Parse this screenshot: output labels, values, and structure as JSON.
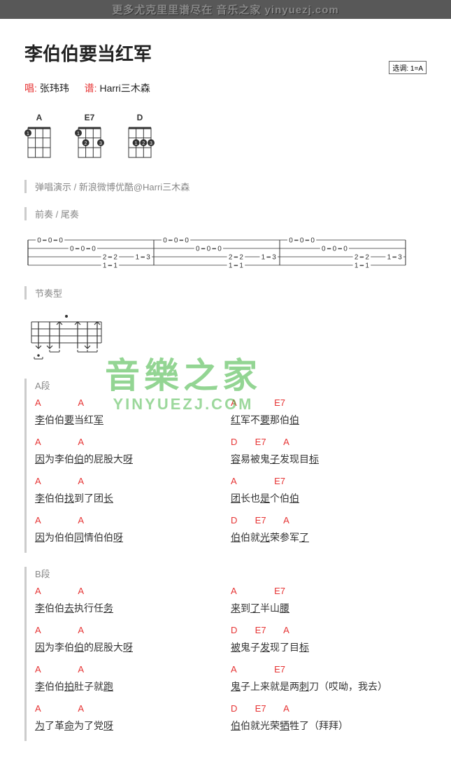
{
  "header_text": "更多尤克里里谱尽在 音乐之家 yinyuezj.com",
  "title": "李伯伯要当红军",
  "key_label": "选调: 1=A",
  "credit_sing_label": "唱:",
  "credit_sing_name": "张玮玮",
  "credit_tab_label": "谱:",
  "credit_tab_name": "Harri三木森",
  "chords": [
    "A",
    "E7",
    "D"
  ],
  "demo_note": "弹唱演示 / 新浪微博优酷@Harri三木森",
  "intro_outro_label": "前奏 / 尾奏",
  "rhythm_label": "节奏型",
  "watermark_cn": "音樂之家",
  "watermark_en": "YINYUEZJ.COM",
  "sectionA_label": "A段",
  "sectionB_label": "B段",
  "A": {
    "r1": {
      "c1_ch": "A               A",
      "c1_ly": "李伯伯要当红军",
      "c2_ch": "A               E7",
      "c2_ly": "红军不要那伯伯"
    },
    "r2": {
      "c1_ch": "A               A",
      "c1_ly": "因为李伯伯的屁股大呀",
      "c2_ch": "D       E7       A",
      "c2_ly": "容易被鬼子发现目标"
    },
    "r3": {
      "c1_ch": "A               A",
      "c1_ly": "李伯伯找到了团长",
      "c2_ch": "A               E7",
      "c2_ly": "团长也是个伯伯"
    },
    "r4": {
      "c1_ch": "A               A",
      "c1_ly": "因为伯伯同情伯伯呀",
      "c2_ch": "D       E7       A",
      "c2_ly": "伯伯就光荣参军了"
    }
  },
  "B": {
    "r1": {
      "c1_ch": "A               A",
      "c1_ly": "李伯伯去执行任务",
      "c2_ch": "A               E7",
      "c2_ly": "来到了半山腰"
    },
    "r2": {
      "c1_ch": "A               A",
      "c1_ly": "因为李伯伯的屁股大呀",
      "c2_ch": "D       E7       A",
      "c2_ly": "被鬼子发现了目标"
    },
    "r3": {
      "c1_ch": "A               A",
      "c1_ly": "李伯伯拍肚子就跑",
      "c2_ch": "A               E7",
      "c2_ly": "鬼子上来就是两刺刀（哎呦，我去）"
    },
    "r4": {
      "c1_ch": "A               A",
      "c1_ly": "为了革命为了党呀",
      "c2_ch": "D       E7       A",
      "c2_ly": "伯伯就光荣牺牲了（拜拜）"
    }
  },
  "chart_data": {
    "type": "table",
    "description": "Ukulele tablature - intro/outro riff, 3 measures, 4 strings (top to bottom: A E C G)",
    "string_names": [
      "A",
      "E",
      "C",
      "G"
    ],
    "measures": [
      {
        "A": [
          0,
          0,
          0,
          null,
          null,
          null,
          null,
          null,
          null,
          null,
          null
        ],
        "E": [
          null,
          null,
          null,
          0,
          0,
          0,
          null,
          null,
          null,
          null,
          null
        ],
        "C": [
          null,
          null,
          null,
          null,
          null,
          null,
          2,
          2,
          null,
          1,
          3
        ],
        "G": [
          null,
          null,
          null,
          null,
          null,
          null,
          1,
          1,
          null,
          null,
          null
        ]
      },
      {
        "A": [
          0,
          0,
          0,
          null,
          null,
          null,
          null,
          null,
          null,
          null,
          null
        ],
        "E": [
          null,
          null,
          null,
          0,
          0,
          0,
          null,
          null,
          null,
          null,
          null
        ],
        "C": [
          null,
          null,
          null,
          null,
          null,
          null,
          2,
          2,
          null,
          1,
          3
        ],
        "G": [
          null,
          null,
          null,
          null,
          null,
          null,
          1,
          1,
          null,
          null,
          null
        ]
      },
      {
        "A": [
          0,
          0,
          0,
          null,
          null,
          null,
          null,
          null,
          null,
          null,
          null
        ],
        "E": [
          null,
          null,
          null,
          0,
          0,
          0,
          null,
          null,
          null,
          null,
          null
        ],
        "C": [
          null,
          null,
          null,
          null,
          null,
          null,
          2,
          2,
          null,
          1,
          3
        ],
        "G": [
          null,
          null,
          null,
          null,
          null,
          null,
          1,
          1,
          null,
          null,
          null
        ]
      }
    ],
    "chord_diagrams": {
      "A": {
        "frets": [
          0,
          0,
          0,
          2
        ],
        "fingers": {
          "pos": [
            [
              4,
              2,
              "1"
            ]
          ]
        }
      },
      "E7": {
        "frets": [
          2,
          0,
          2,
          1
        ],
        "fingers": {
          "pos": [
            [
              1,
              1,
              "1"
            ],
            [
              2,
              2,
              "2"
            ],
            [
              4,
              2,
              "3"
            ]
          ]
        }
      },
      "D": {
        "frets": [
          0,
          2,
          2,
          2
        ],
        "fingers": {
          "pos": [
            [
              2,
              2,
              "1"
            ],
            [
              3,
              2,
              "2"
            ],
            [
              4,
              2,
              "3"
            ]
          ]
        }
      }
    },
    "strum_pattern": [
      "D",
      "D",
      "U",
      "",
      "U",
      "D",
      "U"
    ]
  }
}
